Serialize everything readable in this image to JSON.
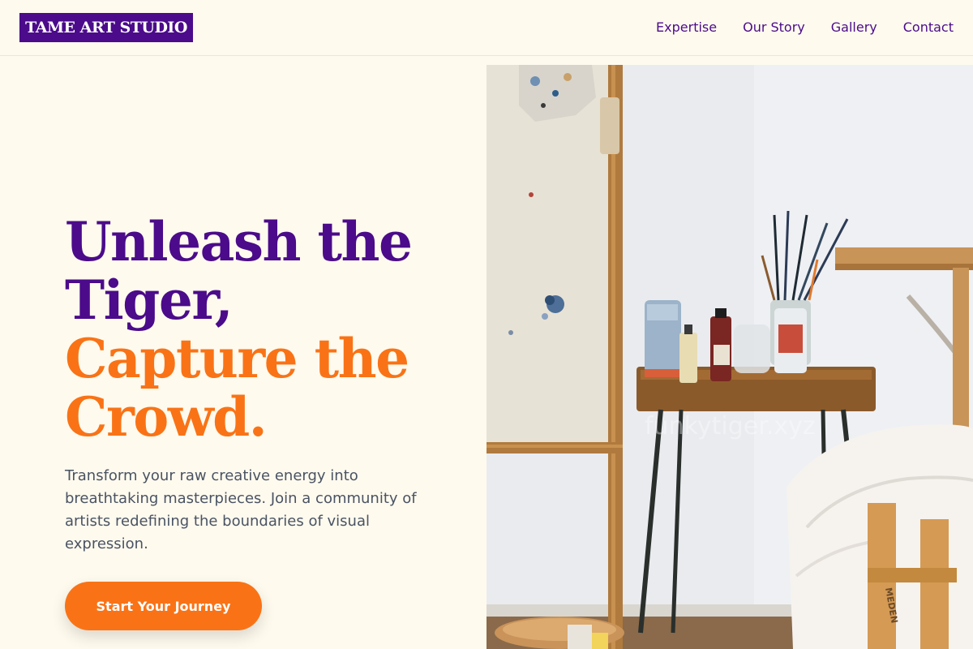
{
  "brand": {
    "name": "TAME ART STUDIO"
  },
  "nav": {
    "items": [
      {
        "label": "Expertise"
      },
      {
        "label": "Our Story"
      },
      {
        "label": "Gallery"
      },
      {
        "label": "Contact"
      }
    ]
  },
  "hero": {
    "title_line1": "Unleash the",
    "title_line2": "Tiger,",
    "title_line3": "Capture the",
    "title_line4": "Crowd.",
    "subtitle": "Transform your raw creative energy into breathtaking masterpieces. Join a community of artists redefining the boundaries of visual expression.",
    "cta_label": "Start Your Journey",
    "image_watermark": "funkytiger.xyz",
    "easel_text": "MEDEN"
  },
  "colors": {
    "primary": "#4b0b8a",
    "accent": "#f97316",
    "background": "#fefaee",
    "body_text": "#4a5363"
  }
}
